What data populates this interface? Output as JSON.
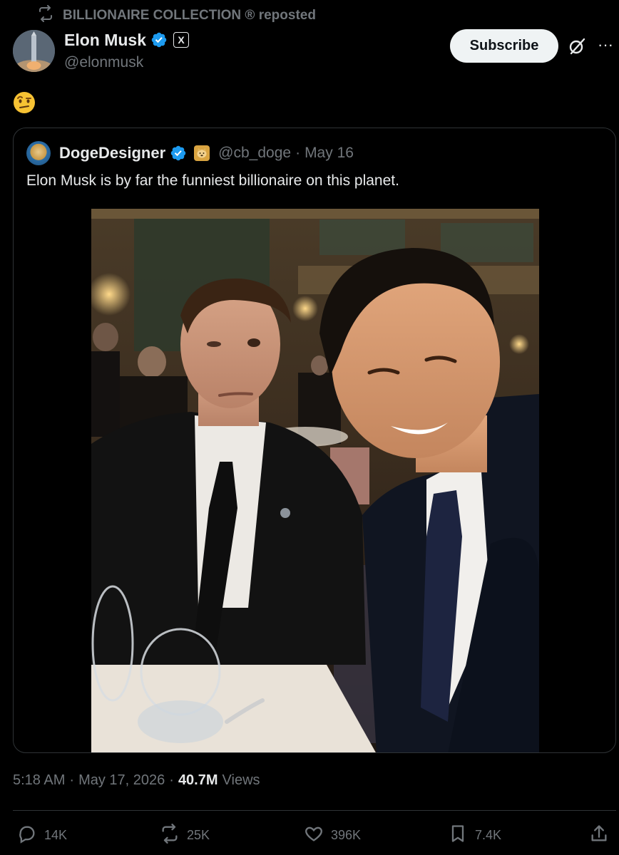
{
  "repost": {
    "label": "BILLIONAIRE COLLECTION ® reposted"
  },
  "author": {
    "name": "Elon Musk",
    "handle": "@elonmusk",
    "badge_letter": "X"
  },
  "header": {
    "subscribe_label": "Subscribe",
    "more_label": "···"
  },
  "tweet": {
    "emoji": "🤨"
  },
  "quote": {
    "name": "DogeDesigner",
    "handle": "@cb_doge",
    "separator": "·",
    "date": "May 16",
    "text": "Elon Musk is by far the funniest billionaire on this planet."
  },
  "meta": {
    "time": "5:18 AM",
    "separator": "·",
    "date": "May 17, 2026",
    "views_count": "40.7M",
    "views_label": "Views"
  },
  "actions": {
    "replies": "14K",
    "reposts": "25K",
    "likes": "396K",
    "bookmarks": "7.4K"
  },
  "colors": {
    "background": "#000000",
    "text": "#e7e9ea",
    "secondary": "#71767b",
    "verified": "#1d9bf0",
    "border": "#2f3336"
  }
}
